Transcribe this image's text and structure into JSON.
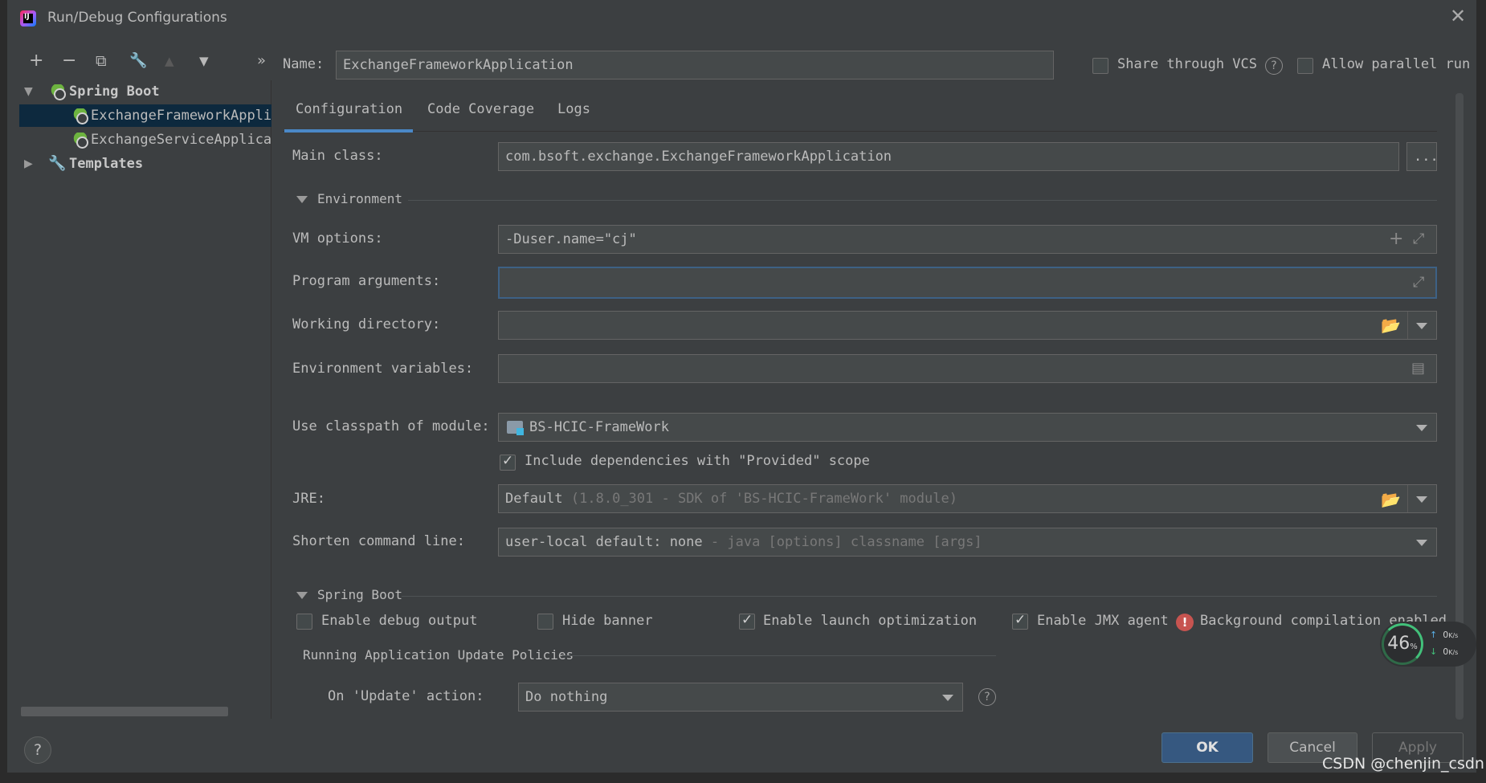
{
  "window": {
    "title": "Run/Debug Configurations",
    "app_icon_text": "IJ",
    "close": "✕"
  },
  "toolbar": {
    "add": "+",
    "remove": "−",
    "copy": "⧉",
    "edit_templates": "🔧",
    "move_up": "▲",
    "move_down": "▼",
    "more": "»"
  },
  "tree": {
    "groups": [
      {
        "label": "Spring Boot",
        "expanded": true,
        "children": [
          "ExchangeFrameworkApplication",
          "ExchangeServiceApplication"
        ]
      },
      {
        "label": "Templates",
        "expanded": false
      }
    ]
  },
  "header": {
    "name_label": "Name:",
    "name_value": "ExchangeFrameworkApplication",
    "share_vcs": {
      "label": "Share through VCS",
      "checked": false
    },
    "allow_parallel": {
      "label": "Allow parallel run",
      "checked": false
    }
  },
  "tabs": [
    {
      "label": "Configuration",
      "active": true
    },
    {
      "label": "Code Coverage",
      "active": false
    },
    {
      "label": "Logs",
      "active": false
    }
  ],
  "config": {
    "main_class": {
      "label": "Main class:",
      "value": "com.bsoft.exchange.ExchangeFrameworkApplication",
      "browse": "..."
    },
    "environment_section": "Environment",
    "vm_options": {
      "label": "VM options:",
      "value": "-Duser.name=\"cj\""
    },
    "program_arguments": {
      "label": "Program arguments:",
      "value": ""
    },
    "working_directory": {
      "label": "Working directory:",
      "value": ""
    },
    "environment_variables": {
      "label": "Environment variables:",
      "value": ""
    },
    "classpath_module": {
      "label": "Use classpath of module:",
      "value": "BS-HCIC-FrameWork"
    },
    "include_provided": {
      "label": "Include dependencies with \"Provided\" scope",
      "checked": true
    },
    "jre": {
      "label": "JRE:",
      "value": "Default",
      "detail": "(1.8.0_301 - SDK of 'BS-HCIC-FrameWork' module)"
    },
    "shorten_command_line": {
      "label": "Shorten command line:",
      "value": "user-local default: none",
      "detail": "- java [options] classname [args]"
    }
  },
  "spring_boot": {
    "section": "Spring Boot",
    "enable_debug_output": {
      "label": "Enable debug output",
      "checked": false
    },
    "hide_banner": {
      "label": "Hide banner",
      "checked": false
    },
    "enable_launch_optimization": {
      "label": "Enable launch optimization",
      "checked": true
    },
    "enable_jmx_agent": {
      "label": "Enable JMX agent",
      "checked": true
    },
    "background_compilation": "Background compilation enabled",
    "update_policies_title": "Running Application Update Policies",
    "on_update_action": {
      "label": "On 'Update' action:",
      "value": "Do nothing"
    }
  },
  "buttons": {
    "help": "?",
    "ok": "OK",
    "cancel": "Cancel",
    "apply": "Apply"
  },
  "net_widget": {
    "percent": "46",
    "percent_unit": "%",
    "up_rate": "0",
    "down_rate": "0",
    "rate_unit": "K/s"
  },
  "watermark": "CSDN @chenjin_csdn",
  "colors": {
    "background": "#3c3f41",
    "selection": "#0d293e",
    "focus_border": "#3d6185",
    "accent_tab": "#4a88c7",
    "ok_button": "#365880",
    "error": "#c75450",
    "spring_green": "#6db33f"
  }
}
